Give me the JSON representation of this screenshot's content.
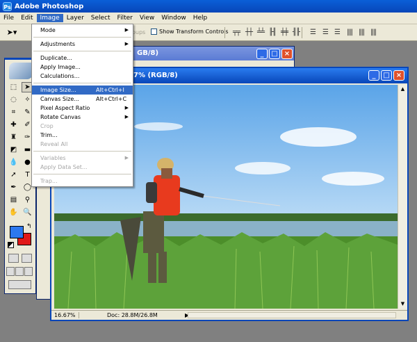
{
  "app": {
    "title": "Adobe Photoshop",
    "logo_text": "Ps"
  },
  "menubar": [
    "File",
    "Edit",
    "Image",
    "Layer",
    "Select",
    "Filter",
    "View",
    "Window",
    "Help"
  ],
  "options": {
    "groups_text": "oups",
    "show_transform_controls": "Show Transform Controls"
  },
  "image_menu": [
    {
      "label": "Mode",
      "submenu": true
    },
    {
      "sep": true
    },
    {
      "label": "Adjustments",
      "submenu": true
    },
    {
      "sep": true
    },
    {
      "label": "Duplicate..."
    },
    {
      "label": "Apply Image..."
    },
    {
      "label": "Calculations..."
    },
    {
      "sep": true
    },
    {
      "label": "Image Size...",
      "shortcut": "Alt+Ctrl+I",
      "highlight": true
    },
    {
      "label": "Canvas Size...",
      "shortcut": "Alt+Ctrl+C"
    },
    {
      "label": "Pixel Aspect Ratio",
      "submenu": true
    },
    {
      "label": "Rotate Canvas",
      "submenu": true
    },
    {
      "label": "Crop",
      "disabled": true
    },
    {
      "label": "Trim..."
    },
    {
      "label": "Reveal All",
      "disabled": true
    },
    {
      "sep": true
    },
    {
      "label": "Variables",
      "submenu": true,
      "disabled": true
    },
    {
      "label": "Apply Data Set...",
      "disabled": true
    },
    {
      "sep": true
    },
    {
      "label": "Trap...",
      "disabled": true
    }
  ],
  "doc_back": {
    "title": "GB/8)"
  },
  "doc_front": {
    "title": "7% (RGB/8)"
  },
  "status": {
    "zoom": "16.67%",
    "doc": "Doc: 28.8M/26.8M"
  },
  "toolbox": {
    "fg_color": "#2d78ef",
    "bg_color": "#e01818"
  }
}
